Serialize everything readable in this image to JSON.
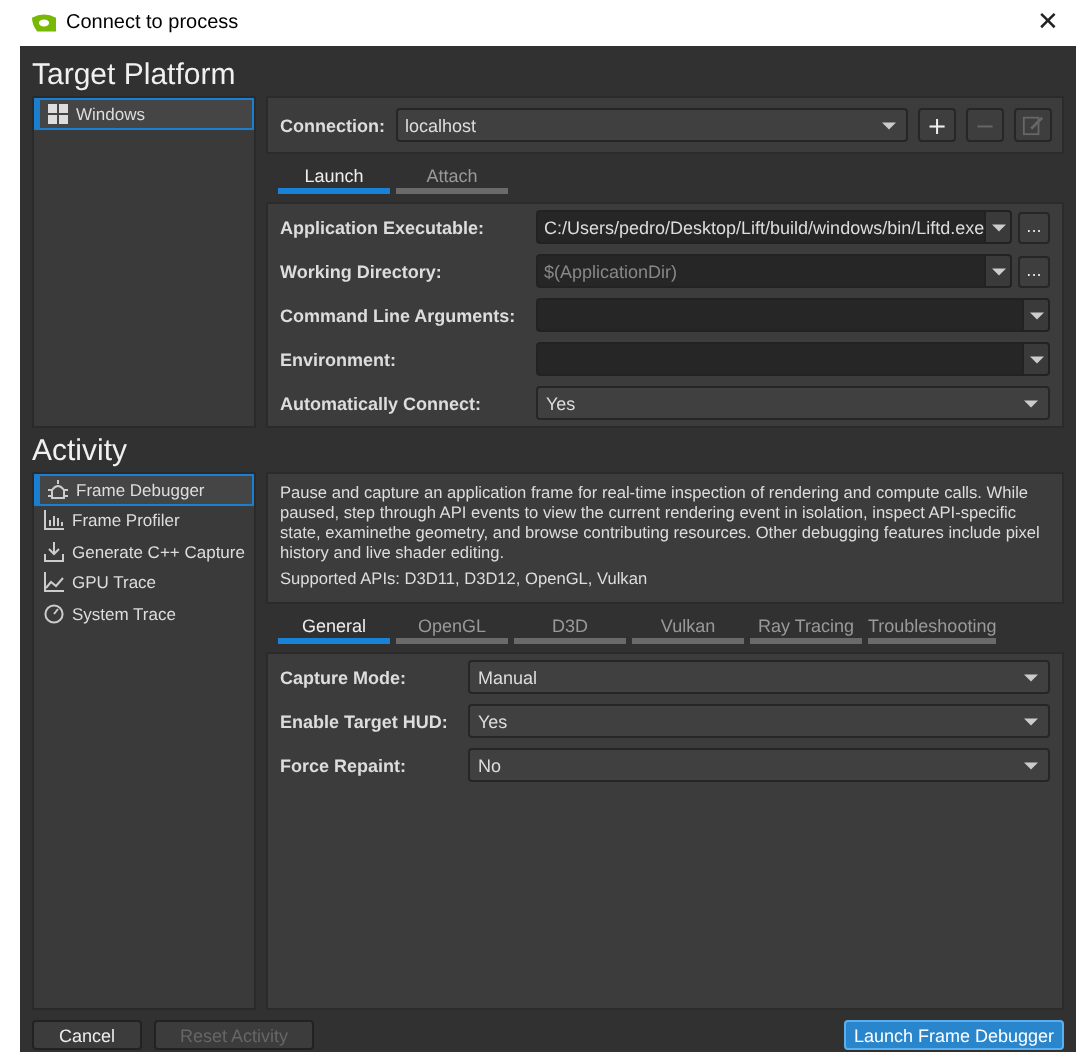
{
  "window": {
    "title": "Connect to process",
    "close_label": "✕"
  },
  "target_platform": {
    "heading": "Target Platform",
    "platforms": [
      {
        "label": "Windows",
        "selected": true
      }
    ],
    "connection": {
      "label": "Connection:",
      "value": "localhost",
      "buttons": [
        {
          "kind": "add",
          "label": "+",
          "disabled": false
        },
        {
          "kind": "remove",
          "label": "−",
          "disabled": true
        },
        {
          "kind": "edit",
          "disabled": true
        }
      ]
    },
    "tabs": [
      {
        "label": "Launch",
        "selected": true
      },
      {
        "label": "Attach",
        "selected": false
      }
    ],
    "fields": [
      {
        "label": "Application Executable:",
        "kind": "combo",
        "value": "C:/Users/pedro/Desktop/Lift/build/windows/bin/Liftd.exe",
        "browse_label": "..."
      },
      {
        "label": "Working Directory:",
        "kind": "combo",
        "placeholder": "$(ApplicationDir)",
        "browse_label": "..."
      },
      {
        "label": "Command Line Arguments:",
        "kind": "combo"
      },
      {
        "label": "Environment:",
        "kind": "combo"
      },
      {
        "label": "Automatically Connect:",
        "kind": "select",
        "value": "Yes"
      }
    ]
  },
  "activity": {
    "heading": "Activity",
    "items": [
      {
        "label": "Frame Debugger",
        "selected": true
      },
      {
        "label": "Frame Profiler",
        "selected": false
      },
      {
        "label": "Generate C++ Capture",
        "selected": false
      },
      {
        "label": "GPU Trace",
        "selected": false
      },
      {
        "label": "System Trace",
        "selected": false
      }
    ],
    "description": "Pause and capture an application frame for real-time inspection of rendering and compute calls. While paused, step through API events to view the current rendering event in isolation, inspect API-specific state, examinethe geometry, and browse contributing resources. Other debugging features include pixel history and live shader editing.",
    "supported_apis": "Supported APIs: D3D11, D3D12, OpenGL, Vulkan",
    "tabs": [
      {
        "label": "General",
        "selected": true
      },
      {
        "label": "OpenGL",
        "selected": false
      },
      {
        "label": "D3D",
        "selected": false
      },
      {
        "label": "Vulkan",
        "selected": false
      },
      {
        "label": "Ray Tracing",
        "selected": false
      },
      {
        "label": "Troubleshooting",
        "selected": false
      }
    ],
    "fields": [
      {
        "label": "Capture Mode:",
        "value": "Manual"
      },
      {
        "label": "Enable Target HUD:",
        "value": "Yes"
      },
      {
        "label": "Force Repaint:",
        "value": "No"
      }
    ]
  },
  "footer": {
    "buttons": [
      {
        "label": "Cancel",
        "disabled": false,
        "primary": false
      },
      {
        "label": "Reset Activity",
        "disabled": true,
        "primary": false
      }
    ],
    "launch": {
      "label": "Launch Frame Debugger",
      "primary": true
    }
  }
}
